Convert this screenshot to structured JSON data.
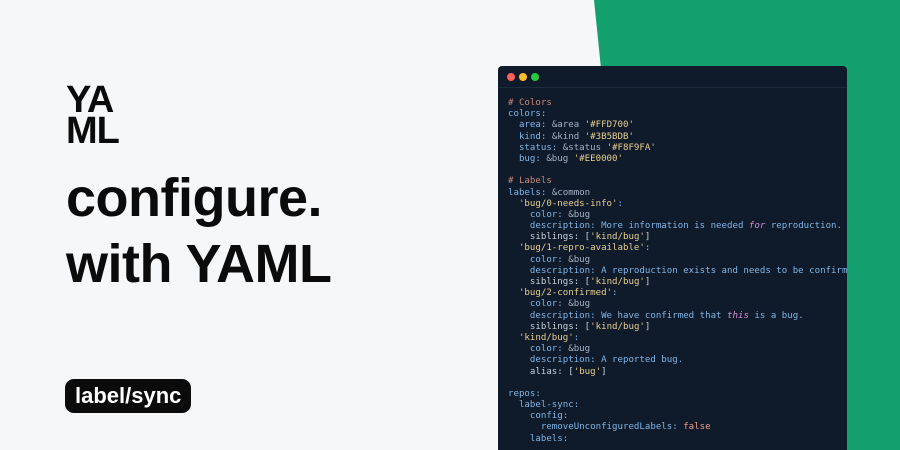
{
  "colors": {
    "background": "#f6f7f9",
    "accent_green": "#13a06e",
    "editor_bg": "#0f1a2a",
    "text_dark": "#0b0b0b"
  },
  "logo": {
    "line1": "YA",
    "line2": "ML"
  },
  "headline": {
    "line1": "configure.",
    "line2": "with YAML"
  },
  "badge": {
    "label": "label/sync"
  },
  "editor": {
    "window_buttons": [
      "close",
      "minimize",
      "maximize"
    ],
    "lines": [
      [
        {
          "t": "# Colors",
          "c": "comment"
        }
      ],
      [
        {
          "t": "colors:",
          "c": "key"
        }
      ],
      [
        {
          "t": "  area: ",
          "c": "key"
        },
        {
          "t": "&area ",
          "c": "anchor"
        },
        {
          "t": "'#FFD700'",
          "c": "string"
        }
      ],
      [
        {
          "t": "  kind: ",
          "c": "key"
        },
        {
          "t": "&kind ",
          "c": "anchor"
        },
        {
          "t": "'#3B5BDB'",
          "c": "string"
        }
      ],
      [
        {
          "t": "  status: ",
          "c": "key"
        },
        {
          "t": "&status ",
          "c": "anchor"
        },
        {
          "t": "'#F8F9FA'",
          "c": "string"
        }
      ],
      [
        {
          "t": "  bug: ",
          "c": "key"
        },
        {
          "t": "&bug ",
          "c": "anchor"
        },
        {
          "t": "'#EE0000'",
          "c": "string"
        }
      ],
      [
        {
          "t": "",
          "c": "plain"
        }
      ],
      [
        {
          "t": "# Labels",
          "c": "comment"
        }
      ],
      [
        {
          "t": "labels: ",
          "c": "key"
        },
        {
          "t": "&common",
          "c": "anchor"
        }
      ],
      [
        {
          "t": "  'bug/0-needs-info'",
          "c": "string"
        },
        {
          "t": ":",
          "c": "key"
        }
      ],
      [
        {
          "t": "    color: ",
          "c": "key"
        },
        {
          "t": "&bug",
          "c": "anchor"
        }
      ],
      [
        {
          "t": "    description: ",
          "c": "key"
        },
        {
          "t": "More information is needed ",
          "c": "key"
        },
        {
          "t": "for",
          "c": "italic"
        },
        {
          "t": " reproduction.",
          "c": "key"
        }
      ],
      [
        {
          "t": "    siblings: ",
          "c": "plain"
        },
        {
          "t": "[",
          "c": "plain"
        },
        {
          "t": "'kind/bug'",
          "c": "string"
        },
        {
          "t": "]",
          "c": "plain"
        }
      ],
      [
        {
          "t": "  'bug/1-repro-available'",
          "c": "string"
        },
        {
          "t": ":",
          "c": "key"
        }
      ],
      [
        {
          "t": "    color: ",
          "c": "key"
        },
        {
          "t": "&bug",
          "c": "anchor"
        }
      ],
      [
        {
          "t": "    description: ",
          "c": "key"
        },
        {
          "t": "A reproduction exists and needs to be confirmed.",
          "c": "key"
        }
      ],
      [
        {
          "t": "    siblings: ",
          "c": "plain"
        },
        {
          "t": "[",
          "c": "plain"
        },
        {
          "t": "'kind/bug'",
          "c": "string"
        },
        {
          "t": "]",
          "c": "plain"
        }
      ],
      [
        {
          "t": "  'bug/2-confirmed'",
          "c": "string"
        },
        {
          "t": ":",
          "c": "key"
        }
      ],
      [
        {
          "t": "    color: ",
          "c": "key"
        },
        {
          "t": "&bug",
          "c": "anchor"
        }
      ],
      [
        {
          "t": "    description: ",
          "c": "key"
        },
        {
          "t": "We have confirmed that ",
          "c": "key"
        },
        {
          "t": "this",
          "c": "italic"
        },
        {
          "t": " is a bug.",
          "c": "key"
        }
      ],
      [
        {
          "t": "    siblings: ",
          "c": "plain"
        },
        {
          "t": "[",
          "c": "plain"
        },
        {
          "t": "'kind/bug'",
          "c": "string"
        },
        {
          "t": "]",
          "c": "plain"
        }
      ],
      [
        {
          "t": "  'kind/bug'",
          "c": "string"
        },
        {
          "t": ":",
          "c": "key"
        }
      ],
      [
        {
          "t": "    color: ",
          "c": "key"
        },
        {
          "t": "&bug",
          "c": "anchor"
        }
      ],
      [
        {
          "t": "    description: ",
          "c": "key"
        },
        {
          "t": "A reported bug.",
          "c": "key"
        }
      ],
      [
        {
          "t": "    alias: ",
          "c": "plain"
        },
        {
          "t": "[",
          "c": "plain"
        },
        {
          "t": "'bug'",
          "c": "string"
        },
        {
          "t": "]",
          "c": "plain"
        }
      ],
      [
        {
          "t": "",
          "c": "plain"
        }
      ],
      [
        {
          "t": "repos:",
          "c": "key"
        }
      ],
      [
        {
          "t": "  label-sync:",
          "c": "key"
        }
      ],
      [
        {
          "t": "    config:",
          "c": "key"
        }
      ],
      [
        {
          "t": "      removeUnconfiguredLabels: ",
          "c": "key"
        },
        {
          "t": "false",
          "c": "bool"
        }
      ],
      [
        {
          "t": "    labels:",
          "c": "key"
        }
      ]
    ]
  }
}
